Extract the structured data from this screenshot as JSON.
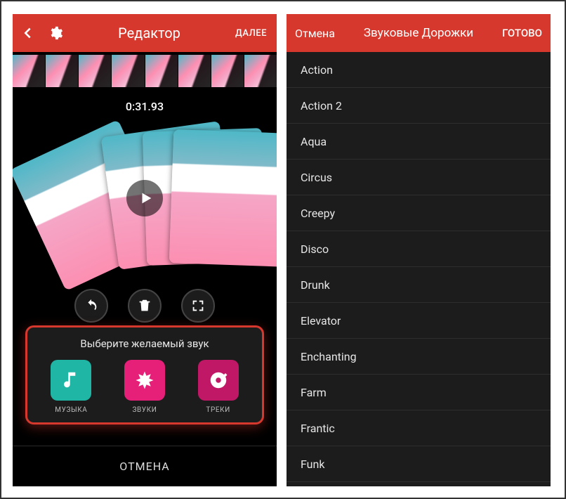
{
  "left": {
    "header": {
      "title": "Редактор",
      "next": "ДАЛЕЕ"
    },
    "timecode": "0:31.93",
    "soundPanel": {
      "title": "Выберите желаемый звук",
      "options": {
        "music": "МУЗЫКА",
        "sounds": "ЗВУКИ",
        "tracks": "ТРЕКИ"
      }
    },
    "cancel": "ОТМЕНА"
  },
  "right": {
    "header": {
      "cancel": "Отмена",
      "title": "Звуковые Дорожки",
      "done": "ГОТОВО"
    },
    "tracks": [
      "Action",
      "Action 2",
      "Aqua",
      "Circus",
      "Creepy",
      "Disco",
      "Drunk",
      "Elevator",
      "Enchanting",
      "Farm",
      "Frantic",
      "Funk"
    ]
  }
}
